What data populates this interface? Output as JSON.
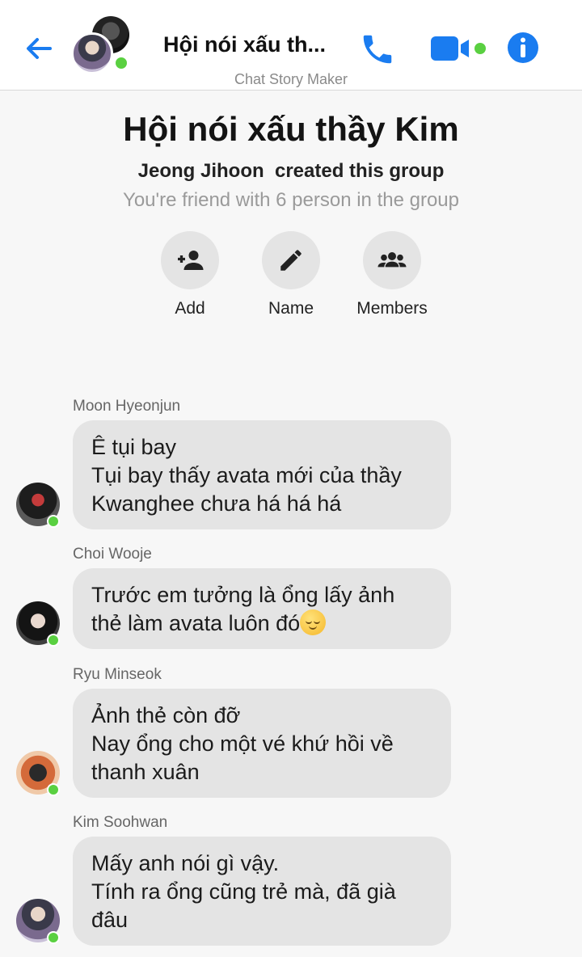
{
  "header": {
    "title": "Hội nói xấu th...",
    "subtitle": "Chat Story Maker",
    "colors": {
      "accent": "#1a7cf0",
      "online": "#5ad041"
    }
  },
  "group": {
    "name": "Hội nói xấu thầy Kim",
    "creator": "Jeong Jihoon",
    "created_text": "created this group",
    "friends_text": "You're friend with 6 person in the group",
    "actions": [
      {
        "label": "Add",
        "icon": "add-person-icon"
      },
      {
        "label": "Name",
        "icon": "pencil-icon"
      },
      {
        "label": "Members",
        "icon": "group-icon"
      }
    ]
  },
  "messages": [
    {
      "sender": "Moon Hyeonjun",
      "lines": [
        "Ê tụi bay",
        "Tụi bay thấy avata mới của thầy",
        "Kwanghee chưa há há há"
      ]
    },
    {
      "sender": "Choi Wooje",
      "lines": [
        "Trước em tưởng là ổng lấy ảnh",
        "thẻ làm avata luôn đó"
      ],
      "emoji": "relieved-face"
    },
    {
      "sender": "Ryu Minseok",
      "lines": [
        "Ảnh thẻ còn đỡ",
        "Nay ổng cho một vé khứ hồi về",
        "thanh xuân"
      ]
    },
    {
      "sender": "Kim Soohwan",
      "lines": [
        "Mấy anh nói gì vậy.",
        "Tính ra ổng cũng trẻ mà, đã già",
        "đâu"
      ]
    }
  ]
}
